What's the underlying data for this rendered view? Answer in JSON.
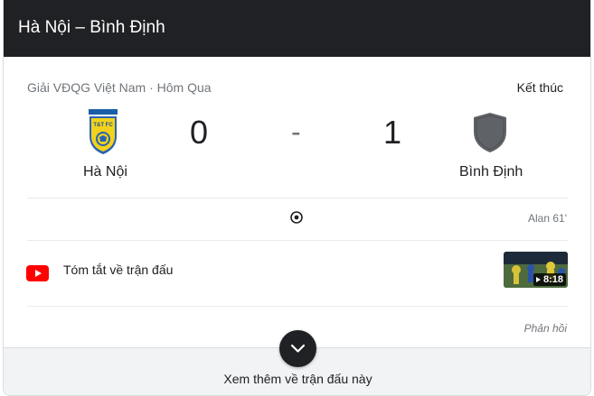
{
  "header": {
    "title": "Hà Nội – Bình Định"
  },
  "match": {
    "competition": "Giải VĐQG Việt Nam · Hôm Qua",
    "status": "Kết thúc",
    "home": {
      "name": "Hà Nội",
      "score": "0",
      "crest_text": "T&T FC"
    },
    "separator": "-",
    "away": {
      "name": "Bình Định",
      "score": "1"
    }
  },
  "events": {
    "scorer": "Alan 61'"
  },
  "highlight": {
    "title": "Tóm tắt về trận đấu",
    "duration": "8:18"
  },
  "feedback_label": "Phản hồi",
  "footer": {
    "more_label": "Xem thêm về trận đấu này"
  },
  "icons": {
    "youtube": "youtube-icon",
    "goal": "soccer-ball-icon",
    "expand": "chevron-down-icon"
  },
  "colors": {
    "header_bg": "#202124",
    "youtube_red": "#ff0000",
    "text_secondary": "#70757a",
    "footer_bg": "#f1f3f4"
  }
}
